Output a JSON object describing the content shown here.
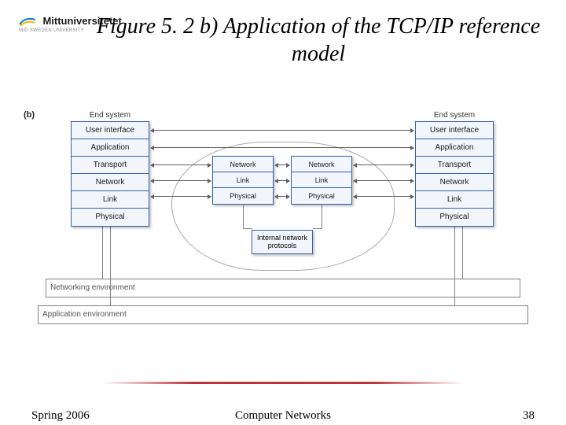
{
  "logo": {
    "name": "Mittuniversitetet",
    "sub": "MID SWEDEN UNIVERSITY"
  },
  "title": "Figure 5. 2 b) Application of the TCP/IP reference model",
  "panel_label": "(b)",
  "end_system_title": "End system",
  "end_layers": [
    "User interface",
    "Application",
    "Transport",
    "Network",
    "Link",
    "Physical"
  ],
  "mid_layers": [
    "Network",
    "Link",
    "Physical"
  ],
  "internal_protocols": "Internal network protocols",
  "env": {
    "networking": "Networking environment",
    "application": "Application environment"
  },
  "footer": {
    "left": "Spring 2006",
    "center": "Computer Networks",
    "right": "38"
  }
}
